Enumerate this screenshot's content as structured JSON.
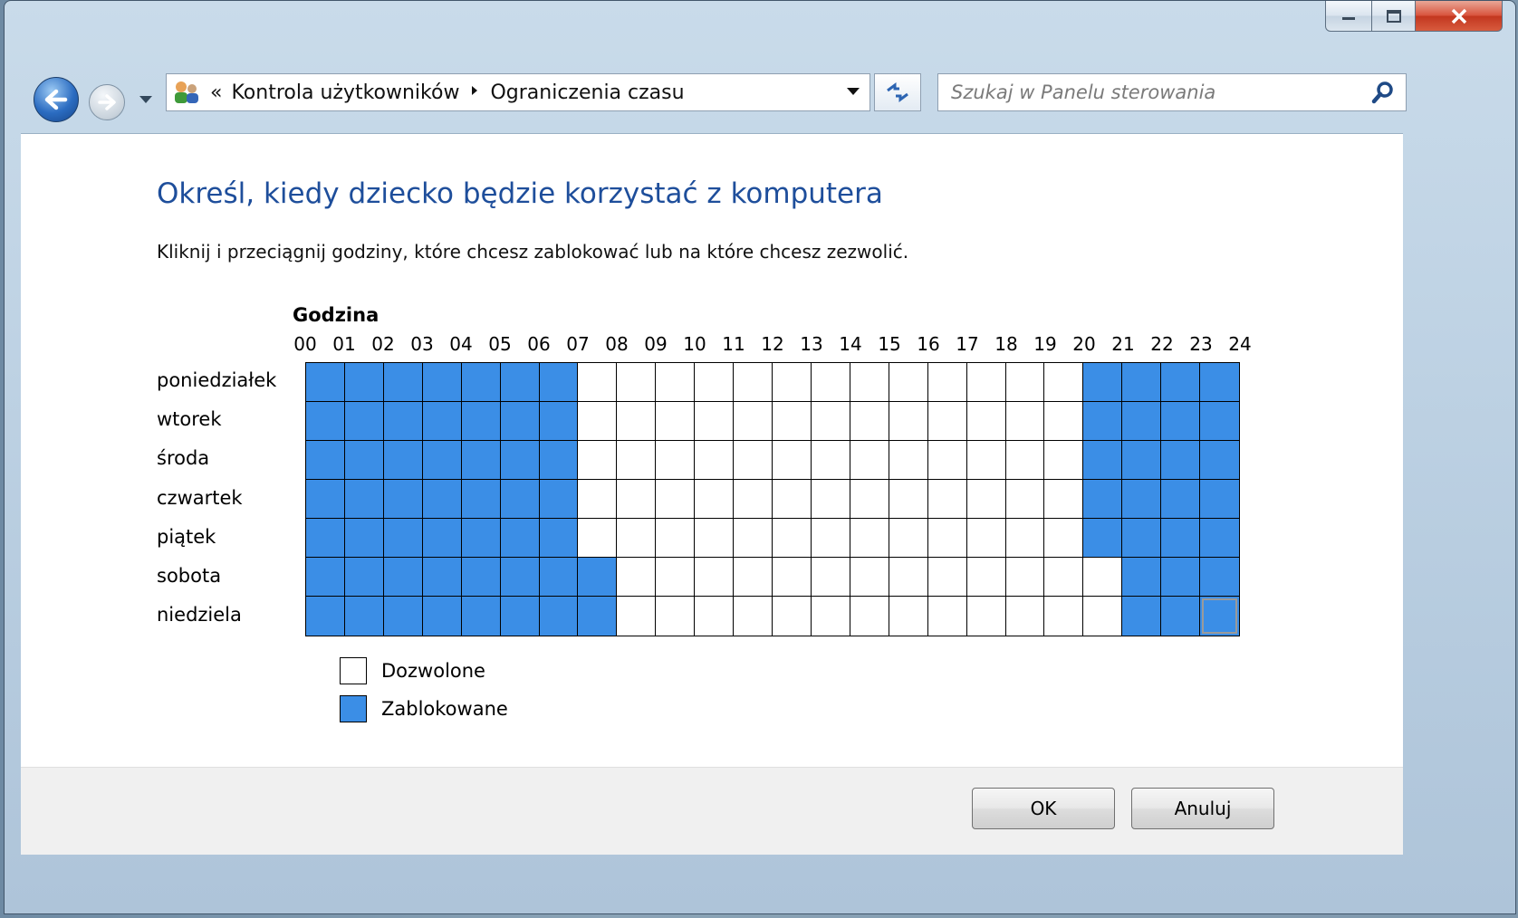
{
  "window": {
    "caption": {
      "minimize": "—",
      "maximize": "▢",
      "close": "X"
    }
  },
  "nav": {
    "address": {
      "chevron": "«",
      "crumbs": [
        "Kontrola użytkowników",
        "Ograniczenia czasu"
      ]
    },
    "search_placeholder": "Szukaj w Panelu sterowania"
  },
  "page": {
    "title": "Określ, kiedy dziecko będzie korzystać z komputera",
    "instruction": "Kliknij i przeciągnij godziny, które chcesz zablokować lub na które chcesz zezwolić."
  },
  "schedule": {
    "hour_header": "Godzina",
    "hours": [
      "00",
      "01",
      "02",
      "03",
      "04",
      "05",
      "06",
      "07",
      "08",
      "09",
      "10",
      "11",
      "12",
      "13",
      "14",
      "15",
      "16",
      "17",
      "18",
      "19",
      "20",
      "21",
      "22",
      "23",
      "24"
    ],
    "days": [
      {
        "label": "poniedziałek",
        "blocked_hours": [
          0,
          1,
          2,
          3,
          4,
          5,
          6,
          20,
          21,
          22,
          23
        ]
      },
      {
        "label": "wtorek",
        "blocked_hours": [
          0,
          1,
          2,
          3,
          4,
          5,
          6,
          20,
          21,
          22,
          23
        ]
      },
      {
        "label": "środa",
        "blocked_hours": [
          0,
          1,
          2,
          3,
          4,
          5,
          6,
          20,
          21,
          22,
          23
        ]
      },
      {
        "label": "czwartek",
        "blocked_hours": [
          0,
          1,
          2,
          3,
          4,
          5,
          6,
          20,
          21,
          22,
          23
        ]
      },
      {
        "label": "piątek",
        "blocked_hours": [
          0,
          1,
          2,
          3,
          4,
          5,
          6,
          20,
          21,
          22,
          23
        ]
      },
      {
        "label": "sobota",
        "blocked_hours": [
          0,
          1,
          2,
          3,
          4,
          5,
          6,
          7,
          21,
          22,
          23
        ]
      },
      {
        "label": "niedziela",
        "blocked_hours": [
          0,
          1,
          2,
          3,
          4,
          5,
          6,
          7,
          21,
          22,
          23
        ]
      }
    ],
    "focused_cell": {
      "day": "niedziela",
      "hour": 23
    },
    "colors": {
      "allowed": "#ffffff",
      "blocked": "#3b8ee6"
    }
  },
  "legend": {
    "allowed": "Dozwolone",
    "blocked": "Zablokowane"
  },
  "buttons": {
    "ok": "OK",
    "cancel": "Anuluj"
  }
}
